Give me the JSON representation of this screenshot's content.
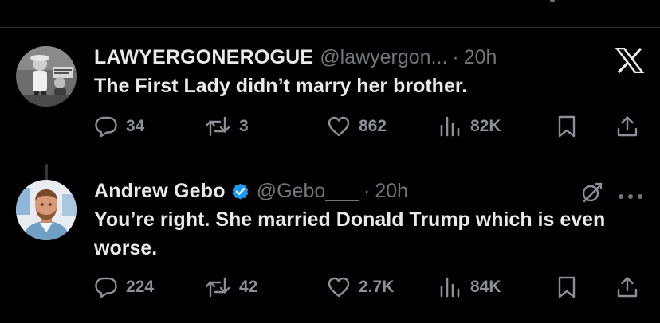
{
  "tweets": [
    {
      "display_name": "LAWYERGONEROGUE",
      "handle": "@lawyergon...",
      "separator": "·",
      "time": "20h",
      "text": "The First Lady didn’t marry her brother.",
      "verified": false,
      "top_icon": "x-logo-icon",
      "actions": {
        "replies": "34",
        "reposts": "3",
        "likes": "862",
        "views": "82K"
      }
    },
    {
      "display_name": "Andrew Gebo",
      "handle": "@Gebo___",
      "separator": "·",
      "time": "20h",
      "text": "You’re right. She married Donald Trump which is even worse.",
      "verified": true,
      "top_icons": [
        "grok-icon",
        "more-icon"
      ],
      "actions": {
        "replies": "224",
        "reposts": "42",
        "likes": "2.7K",
        "views": "84K"
      }
    }
  ],
  "colors": {
    "background": "#000000",
    "primary_text": "#e7e9ea",
    "secondary_text": "#71767b",
    "verified_blue": "#1d9bf0",
    "divider": "#2f3336"
  }
}
